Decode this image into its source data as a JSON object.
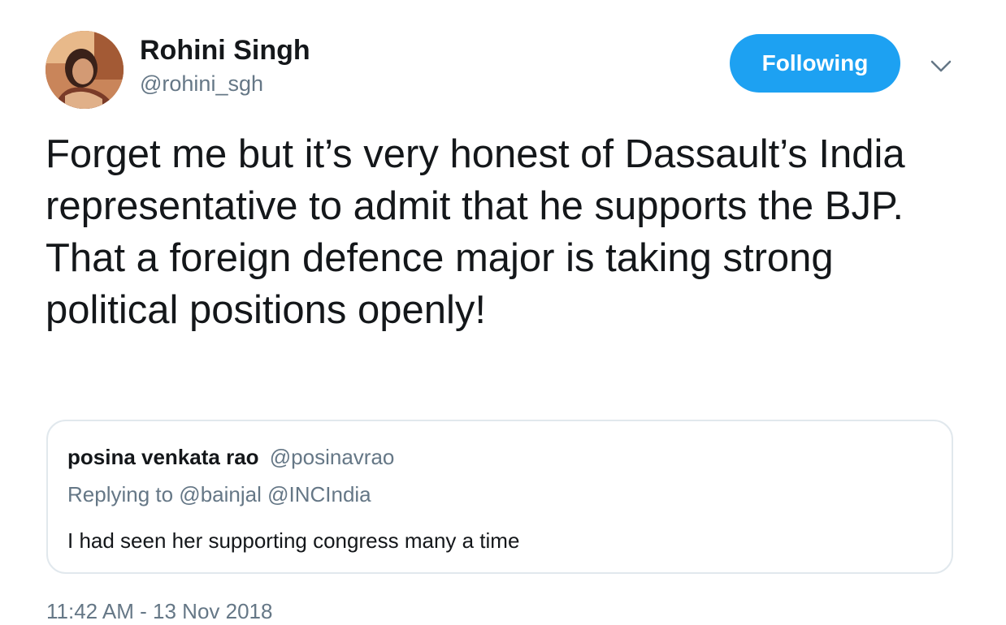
{
  "author": {
    "name": "Rohini Singh",
    "handle": "@rohini_sgh"
  },
  "follow_button": {
    "label": "Following",
    "color": "#1da1f2"
  },
  "menu": {
    "icon": "chevron-down-icon"
  },
  "tweet": {
    "text": "Forget me but it’s very honest of Dassault’s India representative to admit that he supports the BJP. That a foreign defence major is taking strong political positions openly!",
    "timestamp": "11:42 AM - 13 Nov 2018"
  },
  "quoted_tweet": {
    "name": "posina venkata rao",
    "handle": "@posinavrao",
    "replying_to": "Replying to @bainjal @INCIndia",
    "text": "I had seen her supporting congress many a time"
  },
  "colors": {
    "text_primary": "#14171a",
    "text_secondary": "#657786",
    "border": "#e1e8ed",
    "accent": "#1da1f2"
  }
}
